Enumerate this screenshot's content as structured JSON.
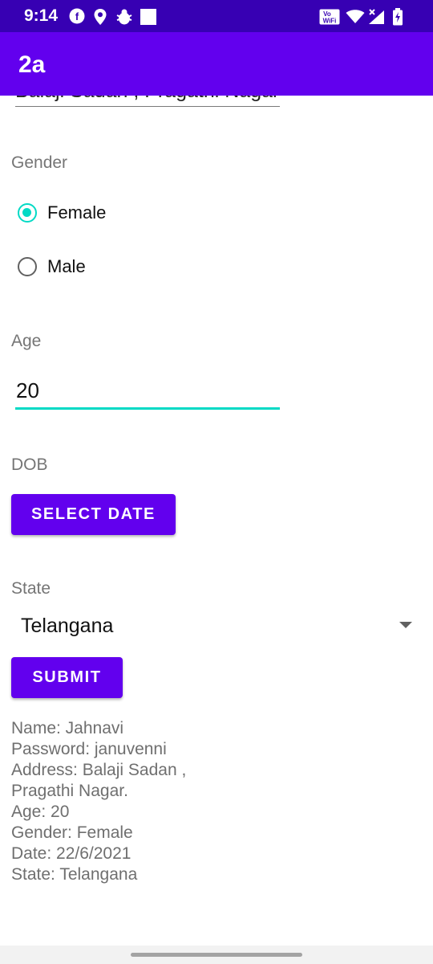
{
  "status_bar": {
    "time": "9:14",
    "notification_icons": [
      "flipkart-icon",
      "location-pin-icon",
      "bug-icon",
      "square-icon"
    ],
    "system_icons": [
      "vowifi-icon",
      "wifi-icon",
      "signal-icon",
      "battery-icon"
    ],
    "vowifi_label_top": "Vo",
    "vowifi_label_bottom": "WiFi"
  },
  "app_bar": {
    "title": "2a"
  },
  "form": {
    "address_value": "Balaji Sadan , Pragathi Nagar.",
    "gender_label": "Gender",
    "gender_options": [
      {
        "label": "Female",
        "checked": true
      },
      {
        "label": "Male",
        "checked": false
      }
    ],
    "age_label": "Age",
    "age_value": "20",
    "dob_label": "DOB",
    "select_date_button": "SELECT DATE",
    "state_label": "State",
    "state_value": "Telangana",
    "submit_button": "SUBMIT"
  },
  "result_lines": [
    "Name: Jahnavi",
    "Password: januvenni",
    "Address: Balaji Sadan ,",
    "Pragathi Nagar.",
    "Age: 20",
    "Gender: Female",
    "Date: 22/6/2021",
    "State: Telangana"
  ],
  "colors": {
    "status_bar": "#3700b3",
    "app_bar": "#6200ee",
    "accent": "#03dac5",
    "button": "#6200ee"
  }
}
